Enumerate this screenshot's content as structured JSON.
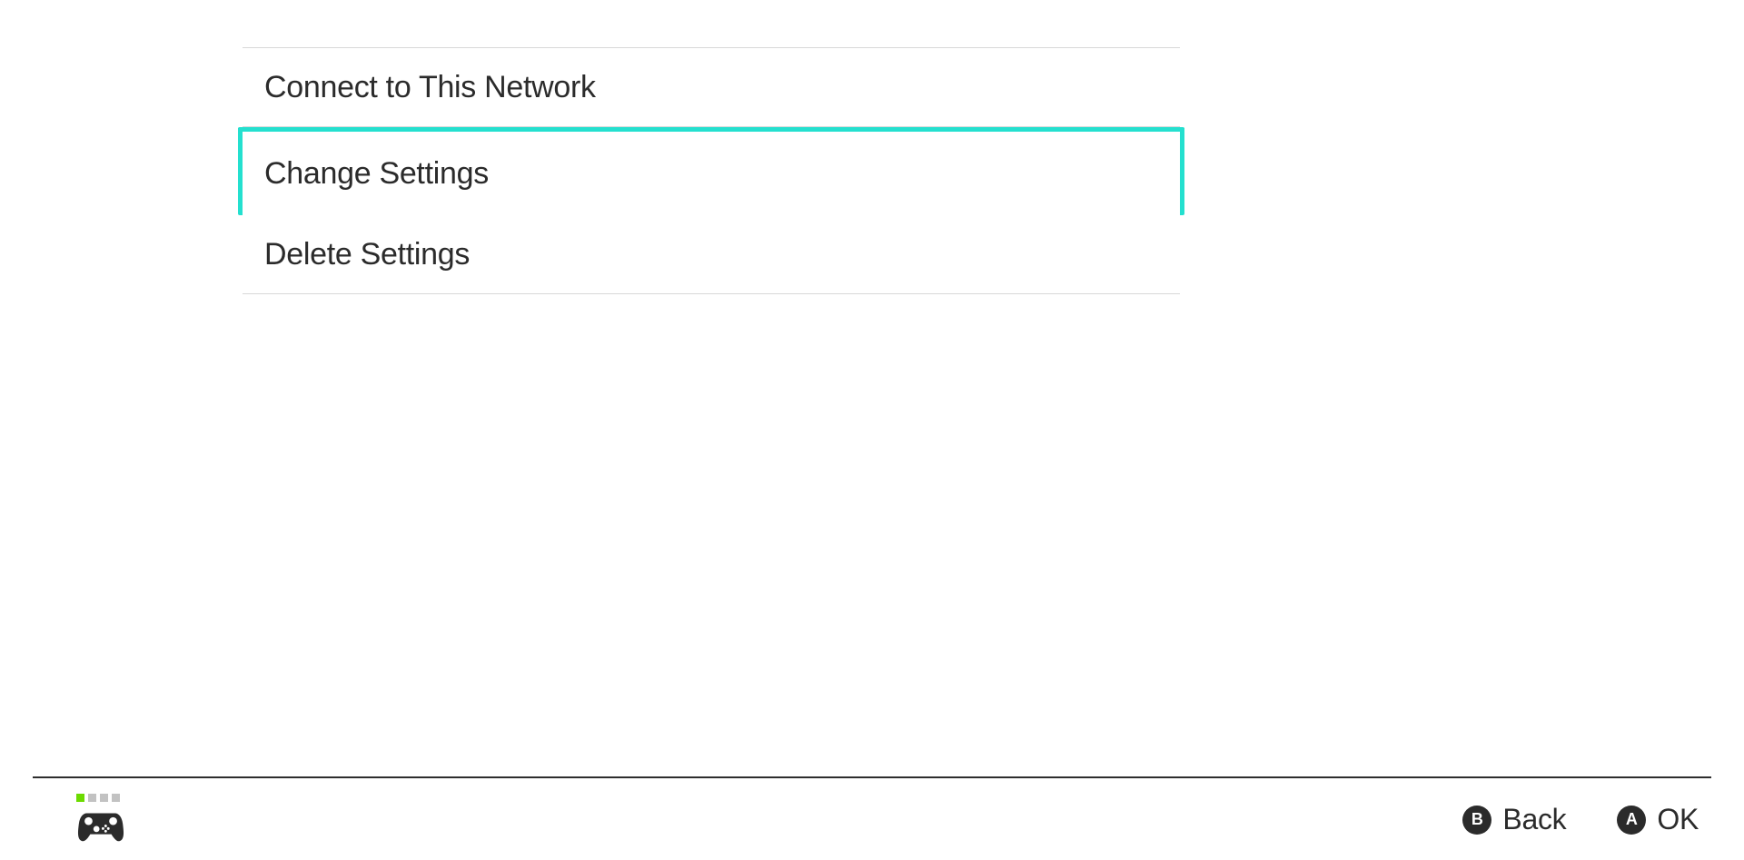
{
  "menu": {
    "items": [
      {
        "label": "Connect to This Network",
        "selected": false
      },
      {
        "label": "Change Settings",
        "selected": true
      },
      {
        "label": "Delete Settings",
        "selected": false
      }
    ]
  },
  "footer": {
    "player_indicator_count": 4,
    "player_active_index": 0,
    "hints": [
      {
        "button": "B",
        "label": "Back"
      },
      {
        "button": "A",
        "label": "OK"
      }
    ]
  },
  "colors": {
    "highlight": "#24e0cf",
    "player_active": "#6cdb00"
  }
}
